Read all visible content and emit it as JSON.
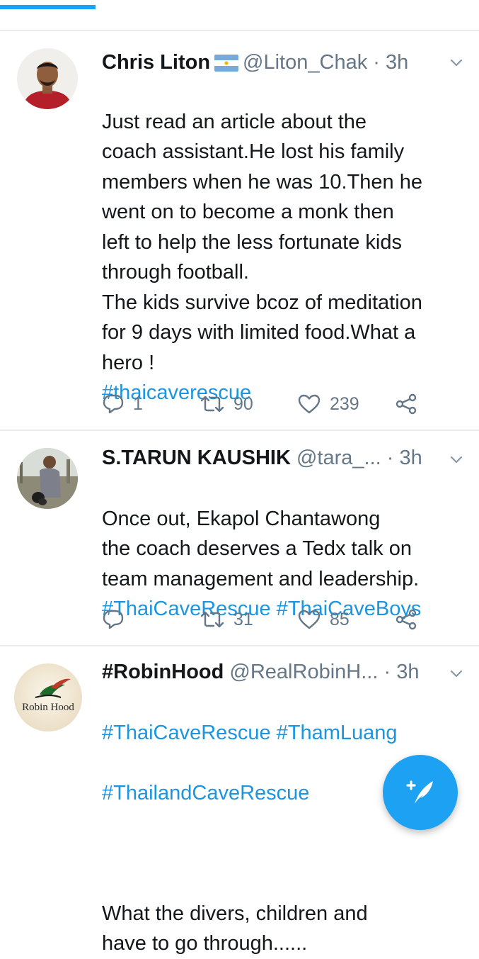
{
  "colors": {
    "accent": "#1da1f2",
    "hashtag": "#1b95e0",
    "muted": "#657786",
    "divider": "#e6ecf0",
    "text": "#14171a"
  },
  "tweets": [
    {
      "name": "Chris Liton",
      "flag": "argentina-flag-icon",
      "handle": "@Liton_Chak",
      "dot": "·",
      "time": "3h",
      "text": "Just read an article about the\ncoach assistant.He lost his family\nmembers when he was 10.Then he\nwent on to become a monk then\nleft to help the less fortunate kids\nthrough football.\nThe kids survive bcoz of meditation\nfor 9 days with limited food.What a\nhero !",
      "hashtags": [
        "#thaicaverescue"
      ],
      "replies": "1",
      "retweets": "90",
      "likes": "239"
    },
    {
      "name": "S.TARUN KAUSHIK",
      "handle": "@tara_...",
      "dot": "·",
      "time": "3h",
      "text": "Once out,  Ekapol Chantawong\nthe coach deserves a Tedx talk on\nteam management and leadership.",
      "hashtags": [
        "#ThaiCaveRescue",
        "#ThaiCaveBoys"
      ],
      "replies": "",
      "retweets": "31",
      "likes": "85"
    },
    {
      "name": "#RobinHood",
      "handle": "@RealRobinH...",
      "dot": "·",
      "time": "3h",
      "avatar_text": "Robin Hood",
      "hashtag_line1": "#ThaiCaveRescue #ThamLuang",
      "hashtag_line2": "#ThailandCaveRescue",
      "text": "What the divers, children and\nhave to go through......"
    }
  ],
  "compose_button": {
    "icon": "compose-tweet-icon"
  }
}
